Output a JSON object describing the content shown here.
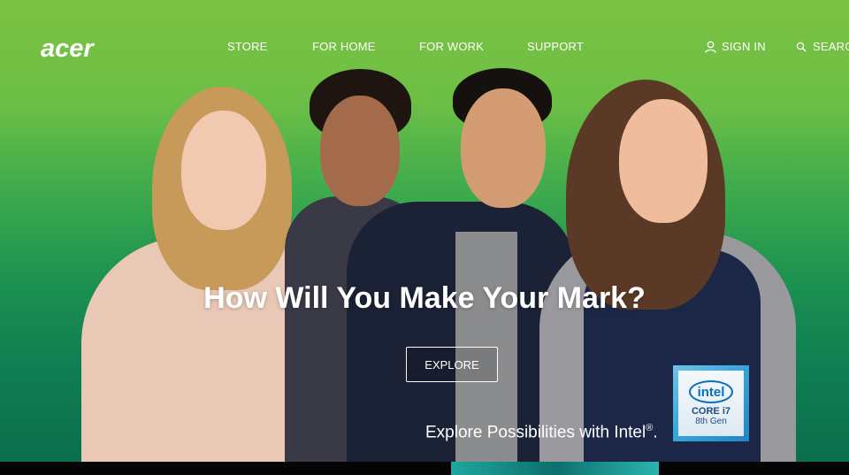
{
  "brand": {
    "logo_text": "acer",
    "logo_icon": "acer-logo"
  },
  "nav": {
    "items": [
      {
        "label": "STORE"
      },
      {
        "label": "FOR HOME"
      },
      {
        "label": "FOR WORK"
      },
      {
        "label": "SUPPORT"
      }
    ],
    "signin": {
      "label": "SIGN IN",
      "icon": "user-icon"
    },
    "search": {
      "label": "SEARCH",
      "icon": "search-icon"
    }
  },
  "hero": {
    "headline": "How Will You Make Your Mark?",
    "cta_label": "EXPLORE",
    "tagline": "Explore Possibilities with Intel",
    "tagline_mark": "®",
    "tagline_end": ".",
    "colors": {
      "top": "#7cc242",
      "bottom": "#0c6f4d"
    }
  },
  "badge": {
    "brand": "intel",
    "line1": "CORE i7",
    "line2": "8th Gen"
  }
}
